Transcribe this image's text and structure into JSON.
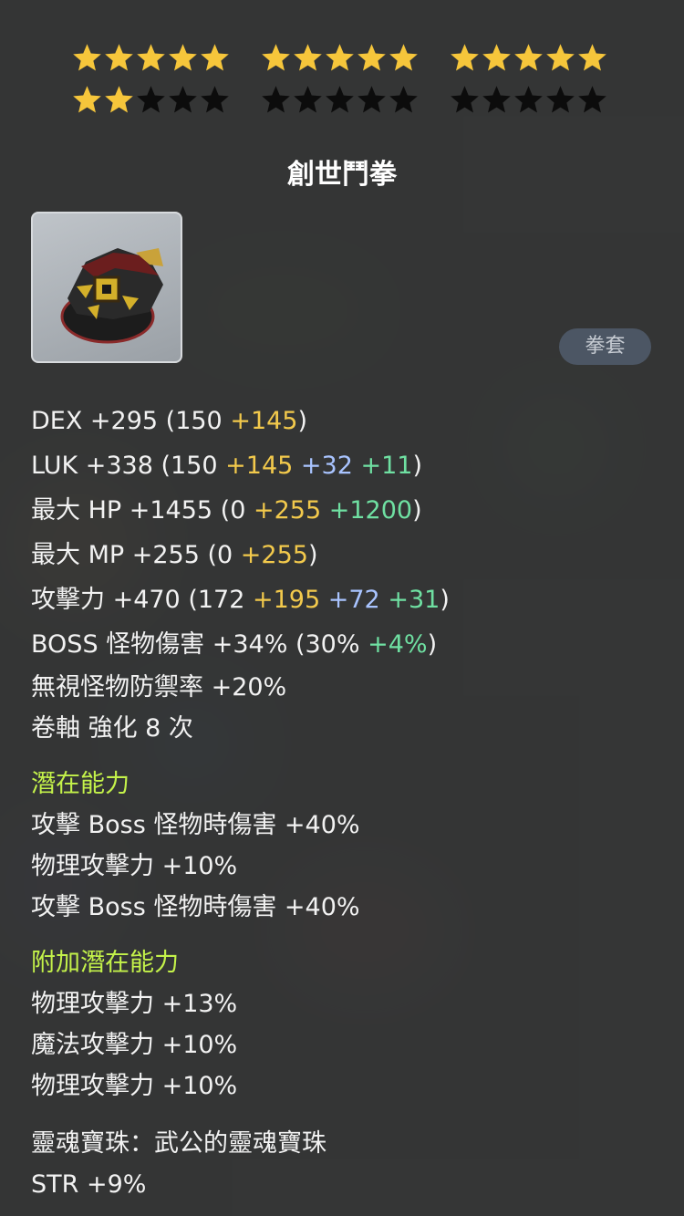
{
  "star_rating": {
    "filled": 17,
    "total": 30,
    "colors": {
      "filled": "#f6c63b",
      "empty": "#0c0c0c"
    }
  },
  "item": {
    "name": "創世鬥拳",
    "category": "拳套",
    "icon": "genesis-knuckle-icon"
  },
  "stats": {
    "dex": {
      "label": "DEX +295 (150 ",
      "base_extra": "+145",
      "close": ")"
    },
    "luk": {
      "label": "LUK +338 (150 ",
      "yellow": "+145",
      "blue": "+32",
      "green": "+11",
      "close": ")"
    },
    "hp": {
      "label": "最大 HP +1455 (0 ",
      "yellow": "+255",
      "green": "+1200",
      "close": ")"
    },
    "mp": {
      "label": "最大 MP +255 (0 ",
      "yellow": "+255",
      "close": ")"
    },
    "atk": {
      "label": "攻擊力 +470  (172 ",
      "yellow": "+195",
      "blue": "+72",
      "green": "+31",
      "close": ")"
    },
    "boss": {
      "label": "BOSS 怪物傷害 +34% (30% ",
      "green": "+4%",
      "close": ")"
    },
    "ignore_def": "無視怪物防禦率 +20%",
    "scroll": "卷軸 強化 8 次"
  },
  "potential": {
    "title": "潛在能力",
    "lines": [
      "攻擊 Boss 怪物時傷害 +40%",
      "物理攻擊力 +10%",
      "攻擊 Boss 怪物時傷害 +40%"
    ]
  },
  "additional_potential": {
    "title": "附加潛在能力",
    "lines": [
      "物理攻擊力 +13%",
      "魔法攻擊力 +10%",
      "物理攻擊力 +10%"
    ]
  },
  "soul": {
    "name": "靈魂寶珠：武公的靈魂寶珠",
    "stat": "STR +9%"
  }
}
